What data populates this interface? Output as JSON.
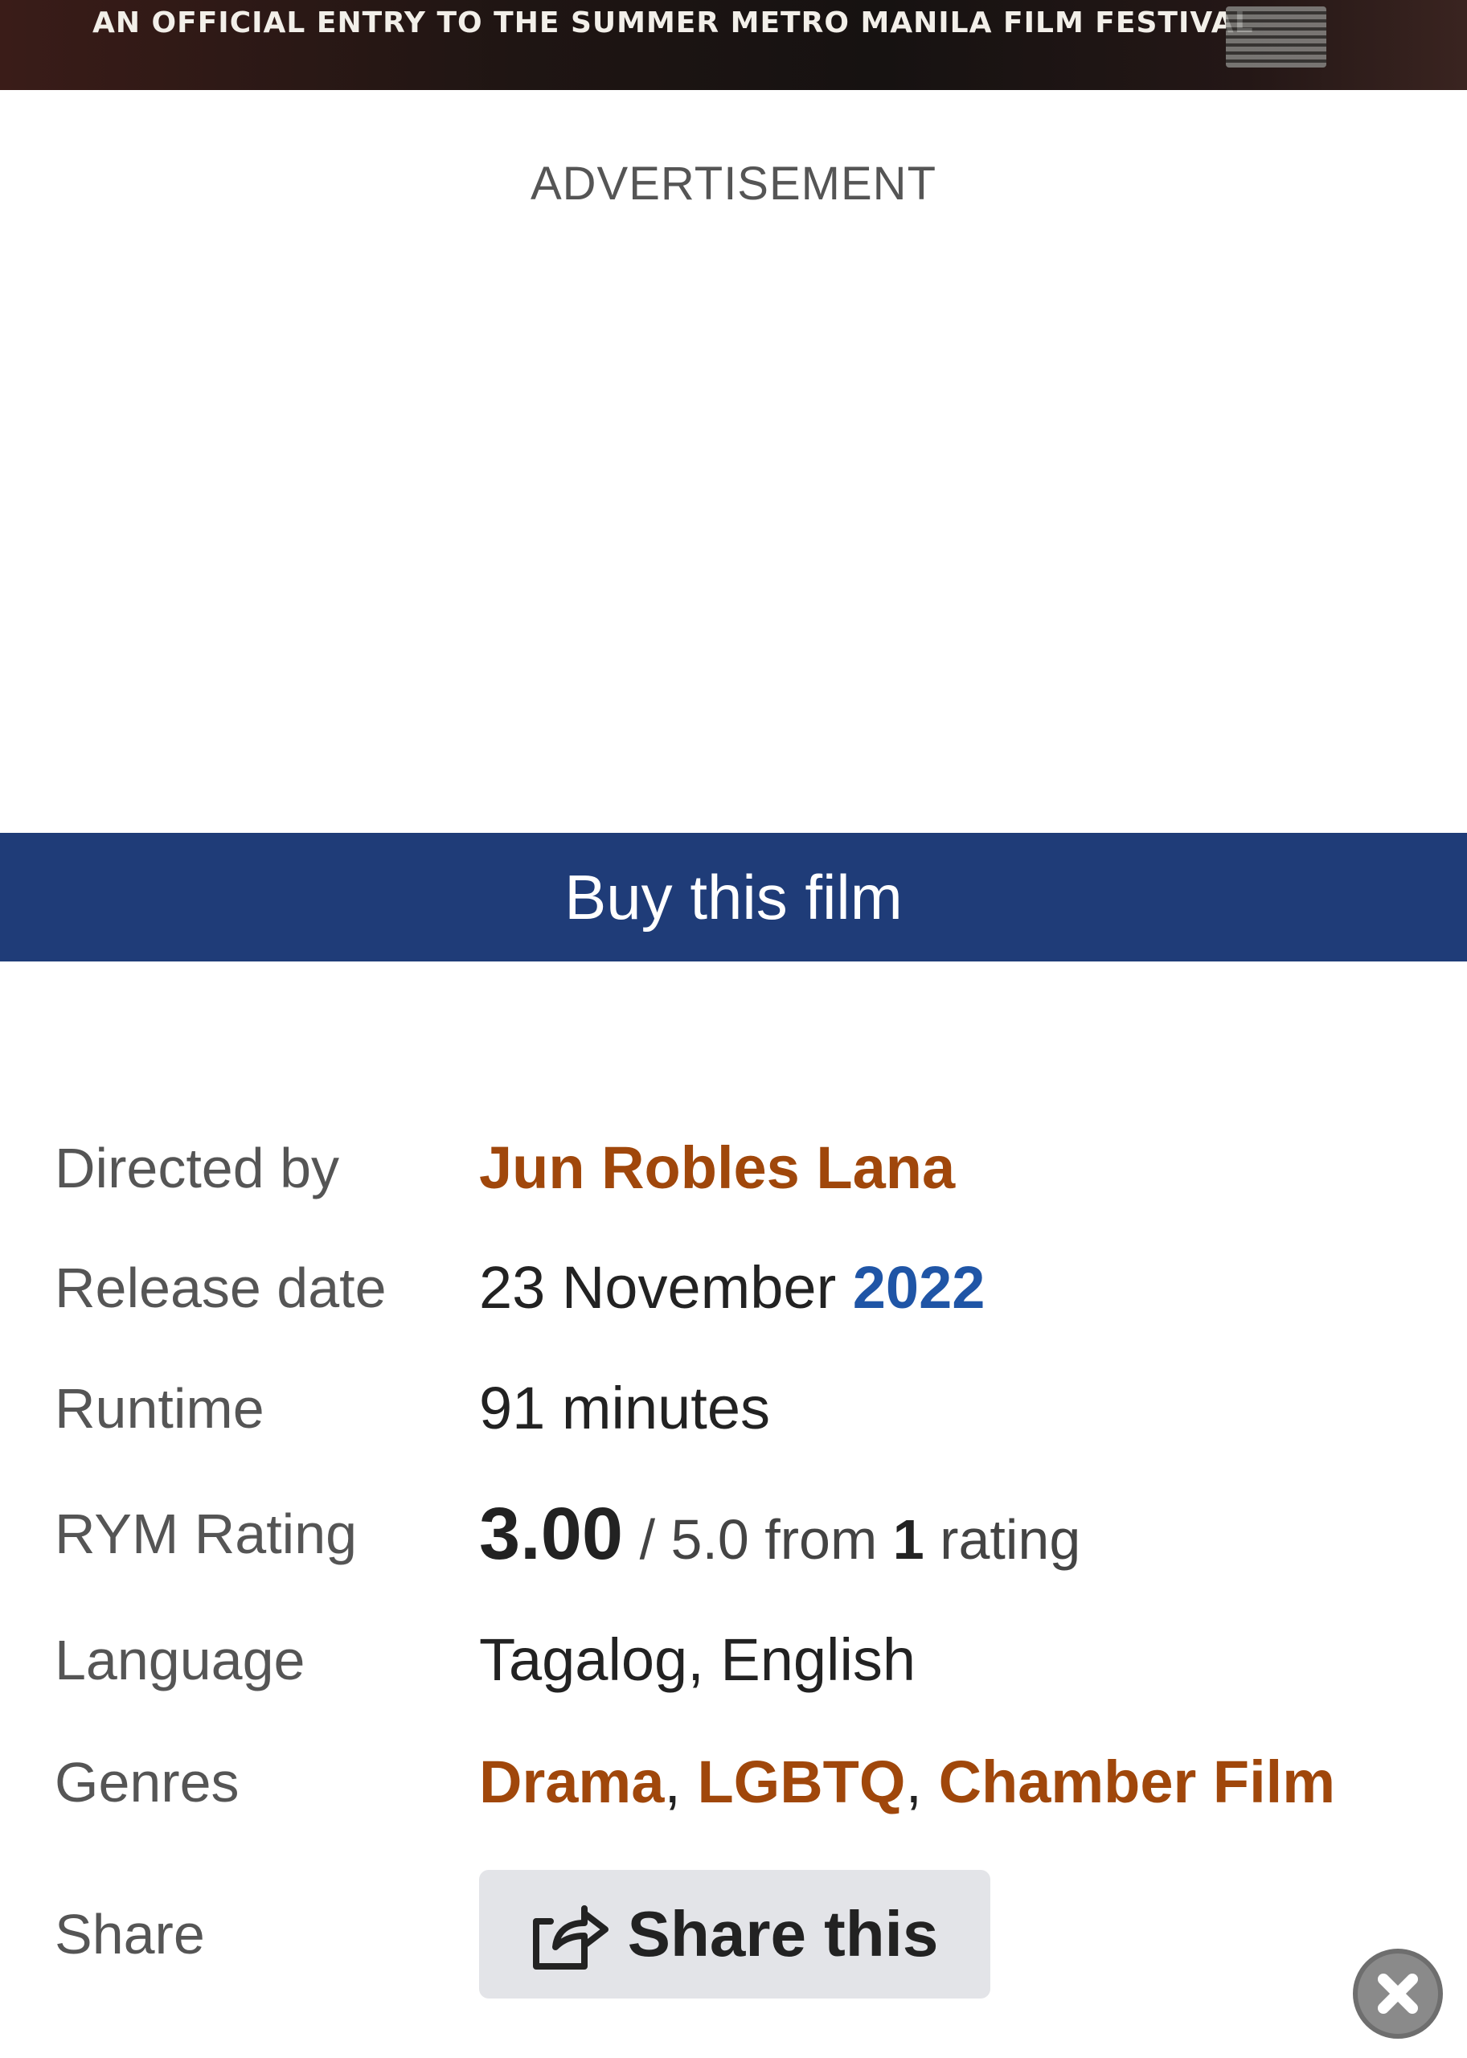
{
  "poster": {
    "tagline": "AN OFFICIAL ENTRY TO THE SUMMER METRO MANILA FILM FESTIVAL",
    "logo_icon": "festival-logo-icon"
  },
  "advertisement": {
    "label": "ADVERTISEMENT"
  },
  "buy": {
    "label": "Buy this film"
  },
  "details": {
    "directed_by": {
      "label": "Directed by",
      "value": "Jun Robles Lana"
    },
    "release_date": {
      "label": "Release date",
      "day_month": "23 November",
      "year": "2022"
    },
    "runtime": {
      "label": "Runtime",
      "value": "91 minutes"
    },
    "rating": {
      "label": "RYM Rating",
      "score": "3.00",
      "max": "/ 5.0",
      "from": "from",
      "count": "1",
      "unit": "rating"
    },
    "language": {
      "label": "Language",
      "value": "Tagalog, English"
    },
    "genres": {
      "label": "Genres",
      "items": [
        "Drama",
        "LGBTQ",
        "Chamber Film"
      ],
      "separator": ","
    },
    "share": {
      "label": "Share",
      "button_label": "Share this",
      "icon": "share-icon"
    }
  },
  "colors": {
    "buy_bar": "#1f3c78",
    "link_brown": "#a0470b",
    "link_blue": "#1f55a6",
    "share_button_bg": "#e3e4e8"
  },
  "close_button": {
    "icon": "close-icon"
  }
}
